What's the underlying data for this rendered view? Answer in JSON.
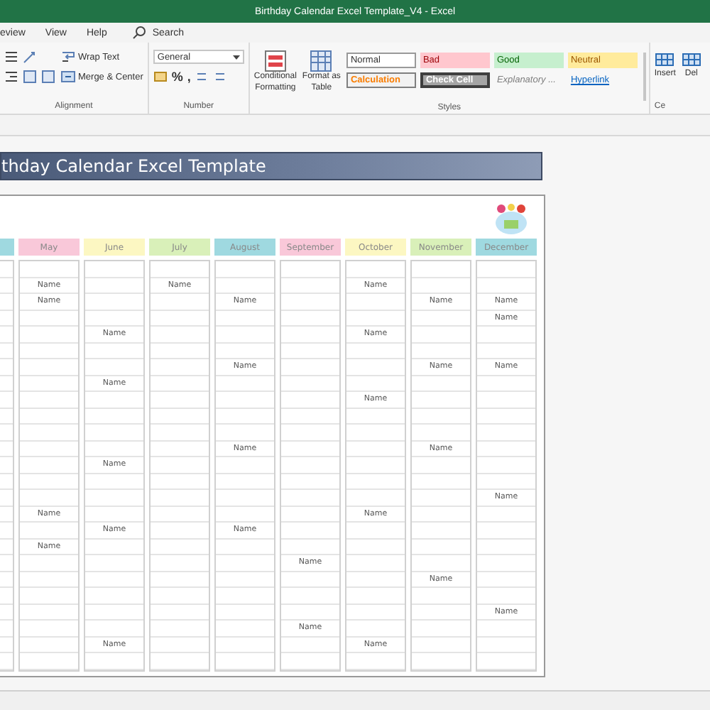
{
  "window": {
    "title": "Birthday Calendar Excel Template_V4  -  Excel"
  },
  "ribbon_tabs": [
    {
      "label": "eview"
    },
    {
      "label": "View"
    },
    {
      "label": "Help"
    }
  ],
  "search": {
    "placeholder": "Search"
  },
  "alignment": {
    "label": "Alignment",
    "wrap_text": "Wrap Text",
    "merge_center": "Merge & Center"
  },
  "number": {
    "label": "Number",
    "format": "General",
    "symbols": [
      "%",
      ","
    ]
  },
  "styles": {
    "label": "Styles",
    "conditional": [
      "Conditional",
      "Formatting"
    ],
    "format_table": [
      "Format as",
      "Table"
    ],
    "gallery": [
      {
        "label": "Normal",
        "kind": "normal"
      },
      {
        "label": "Bad",
        "kind": "bad"
      },
      {
        "label": "Good",
        "kind": "good"
      },
      {
        "label": "Neutral",
        "kind": "neutral"
      },
      {
        "label": "Calculation",
        "kind": "calculation"
      },
      {
        "label": "Check Cell",
        "kind": "check"
      },
      {
        "label": "Explanatory ...",
        "kind": "explanatory"
      },
      {
        "label": "Hyperlink",
        "kind": "hyperlink"
      }
    ]
  },
  "cells_group": {
    "label": "Ce",
    "buttons": [
      "Insert",
      "Del"
    ]
  },
  "sheet": {
    "title": "thday Calendar Excel Template",
    "months": [
      {
        "color": "#9fd9e0",
        "cells": [
          null,
          null,
          null,
          null,
          null,
          null,
          null,
          null,
          null,
          null,
          null,
          null,
          null,
          null,
          null,
          null,
          null,
          null,
          null,
          null,
          null,
          null,
          null,
          null,
          null
        ]
      },
      {
        "label": "May",
        "color": "#f9c8d9",
        "cells": [
          null,
          "Name",
          "Name",
          null,
          null,
          null,
          null,
          null,
          null,
          null,
          null,
          null,
          null,
          null,
          null,
          "Name",
          null,
          "Name",
          null,
          null,
          null,
          null,
          null,
          null,
          null
        ]
      },
      {
        "label": "June",
        "color": "#fcf7c2",
        "cells": [
          null,
          null,
          null,
          null,
          "Name",
          null,
          null,
          "Name",
          null,
          null,
          null,
          null,
          "Name",
          null,
          null,
          null,
          "Name",
          null,
          null,
          null,
          null,
          null,
          null,
          "Name",
          null
        ]
      },
      {
        "label": "July",
        "color": "#d9f0b9",
        "cells": [
          null,
          "Name",
          null,
          null,
          null,
          null,
          null,
          null,
          null,
          null,
          null,
          null,
          null,
          null,
          null,
          null,
          null,
          null,
          null,
          null,
          null,
          null,
          null,
          null,
          null
        ]
      },
      {
        "label": "August",
        "color": "#9fd9e0",
        "cells": [
          null,
          null,
          "Name",
          null,
          null,
          null,
          "Name",
          null,
          null,
          null,
          null,
          "Name",
          null,
          null,
          null,
          null,
          "Name",
          null,
          null,
          null,
          null,
          null,
          null,
          null,
          null
        ]
      },
      {
        "label": "September",
        "color": "#f9c8d9",
        "cells": [
          null,
          null,
          null,
          null,
          null,
          null,
          null,
          null,
          null,
          null,
          null,
          null,
          null,
          null,
          null,
          null,
          null,
          null,
          "Name",
          null,
          null,
          null,
          "Name",
          null,
          null
        ]
      },
      {
        "label": "October",
        "color": "#fcf7c2",
        "cells": [
          null,
          "Name",
          null,
          null,
          "Name",
          null,
          null,
          null,
          "Name",
          null,
          null,
          null,
          null,
          null,
          null,
          "Name",
          null,
          null,
          null,
          null,
          null,
          null,
          null,
          "Name",
          null
        ]
      },
      {
        "label": "November",
        "color": "#d9f0b9",
        "cells": [
          null,
          null,
          "Name",
          null,
          null,
          null,
          "Name",
          null,
          null,
          null,
          null,
          "Name",
          null,
          null,
          null,
          null,
          null,
          null,
          null,
          "Name",
          null,
          null,
          null,
          null,
          null
        ]
      },
      {
        "label": "December",
        "color": "#9fd9e0",
        "cells": [
          null,
          null,
          "Name",
          "Name",
          null,
          null,
          "Name",
          null,
          null,
          null,
          null,
          null,
          null,
          null,
          "Name",
          null,
          null,
          null,
          null,
          null,
          null,
          "Name",
          null,
          null,
          null
        ]
      }
    ]
  }
}
